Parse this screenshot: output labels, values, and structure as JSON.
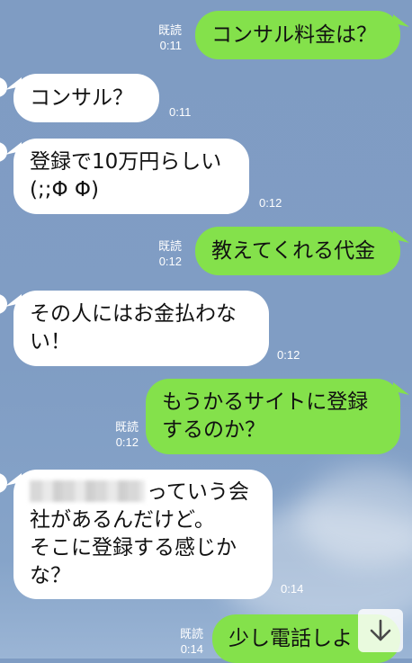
{
  "messages": [
    {
      "id": "m1",
      "side": "out",
      "read": "既読",
      "time": "0:11",
      "lines": [
        "コンサル料金は？"
      ]
    },
    {
      "id": "m2",
      "side": "in",
      "time": "0:11",
      "lines": [
        "コンサル？"
      ]
    },
    {
      "id": "m3",
      "side": "in",
      "time": "0:12",
      "lines": [
        "登録で10万円らしい",
        "(;;Φ Φ)"
      ]
    },
    {
      "id": "m4",
      "side": "out",
      "read": "既読",
      "time": "0:12",
      "lines": [
        "教えてくれる代金"
      ]
    },
    {
      "id": "m5",
      "side": "in",
      "time": "0:12",
      "lines": [
        "その人にはお金払わな",
        "い！"
      ]
    },
    {
      "id": "m6",
      "side": "out",
      "read": "既読",
      "time": "0:12",
      "lines": [
        "もうかるサイトに登録",
        "するのか？"
      ]
    },
    {
      "id": "m7",
      "side": "in",
      "time": "0:14",
      "lines": [
        "っていう会",
        "社があるんだけど。",
        "そこに登録する感じか",
        "な？"
      ]
    },
    {
      "id": "m8",
      "side": "out",
      "read": "既読",
      "time": "0:14",
      "lines": [
        "少し電話しよ"
      ]
    }
  ],
  "scroll_button": {
    "icon": "arrow-down-icon",
    "glyph": "↓"
  },
  "colors": {
    "outgoing": "#84e14b",
    "incoming": "#ffffff",
    "background": "#809dc4",
    "meta_text": "#ffffff"
  }
}
